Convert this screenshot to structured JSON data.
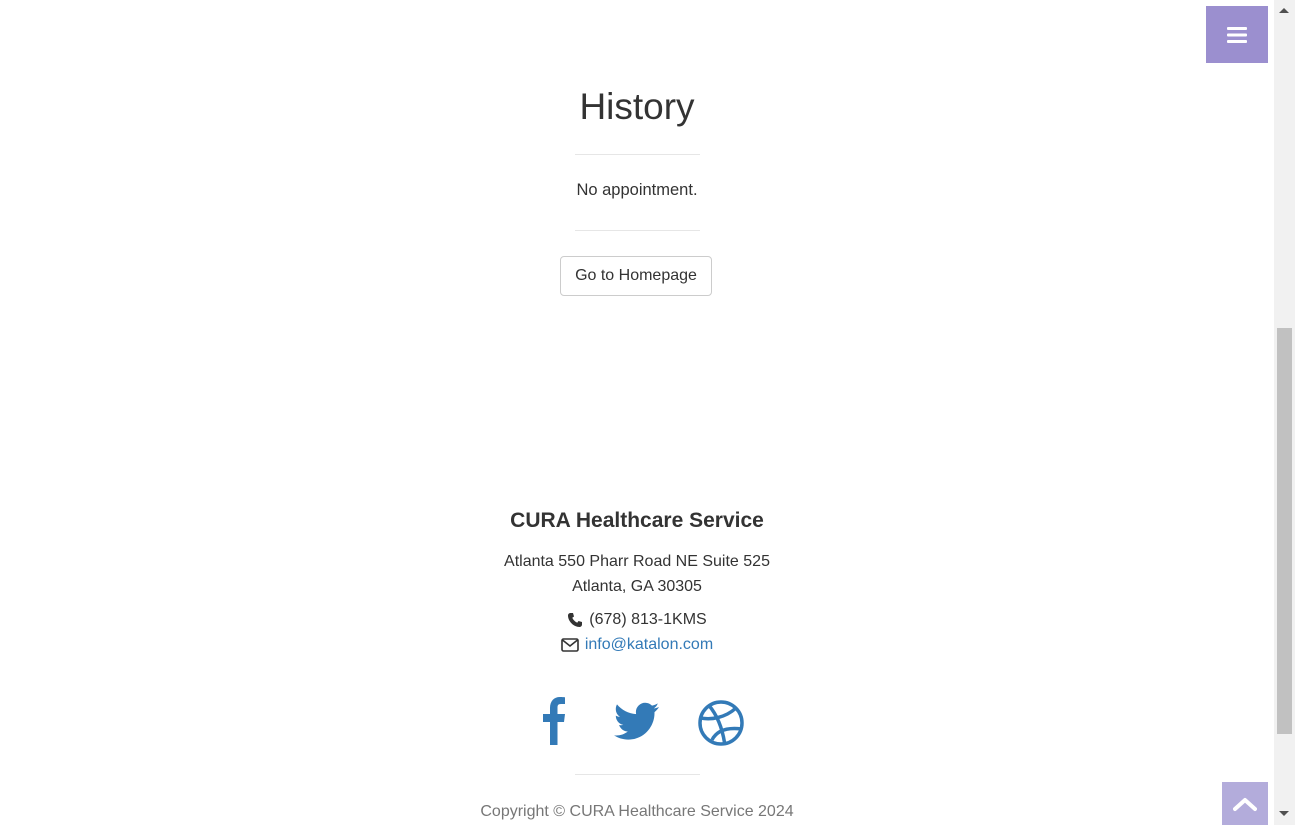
{
  "history": {
    "title": "History",
    "empty_message": "No appointment.",
    "home_button": "Go to Homepage"
  },
  "footer": {
    "brand": "CURA Healthcare Service",
    "address_line1": "Atlanta 550 Pharr Road NE Suite 525",
    "address_line2": "Atlanta, GA 30305",
    "phone": "(678) 813-1KMS",
    "email": "info@katalon.com",
    "copyright": "Copyright © CURA Healthcare Service 2024",
    "social": [
      "facebook-icon",
      "twitter-icon",
      "dribbble-icon"
    ]
  },
  "colors": {
    "accent": "#9b8fcf",
    "link": "#337ab7",
    "text": "#333333"
  }
}
